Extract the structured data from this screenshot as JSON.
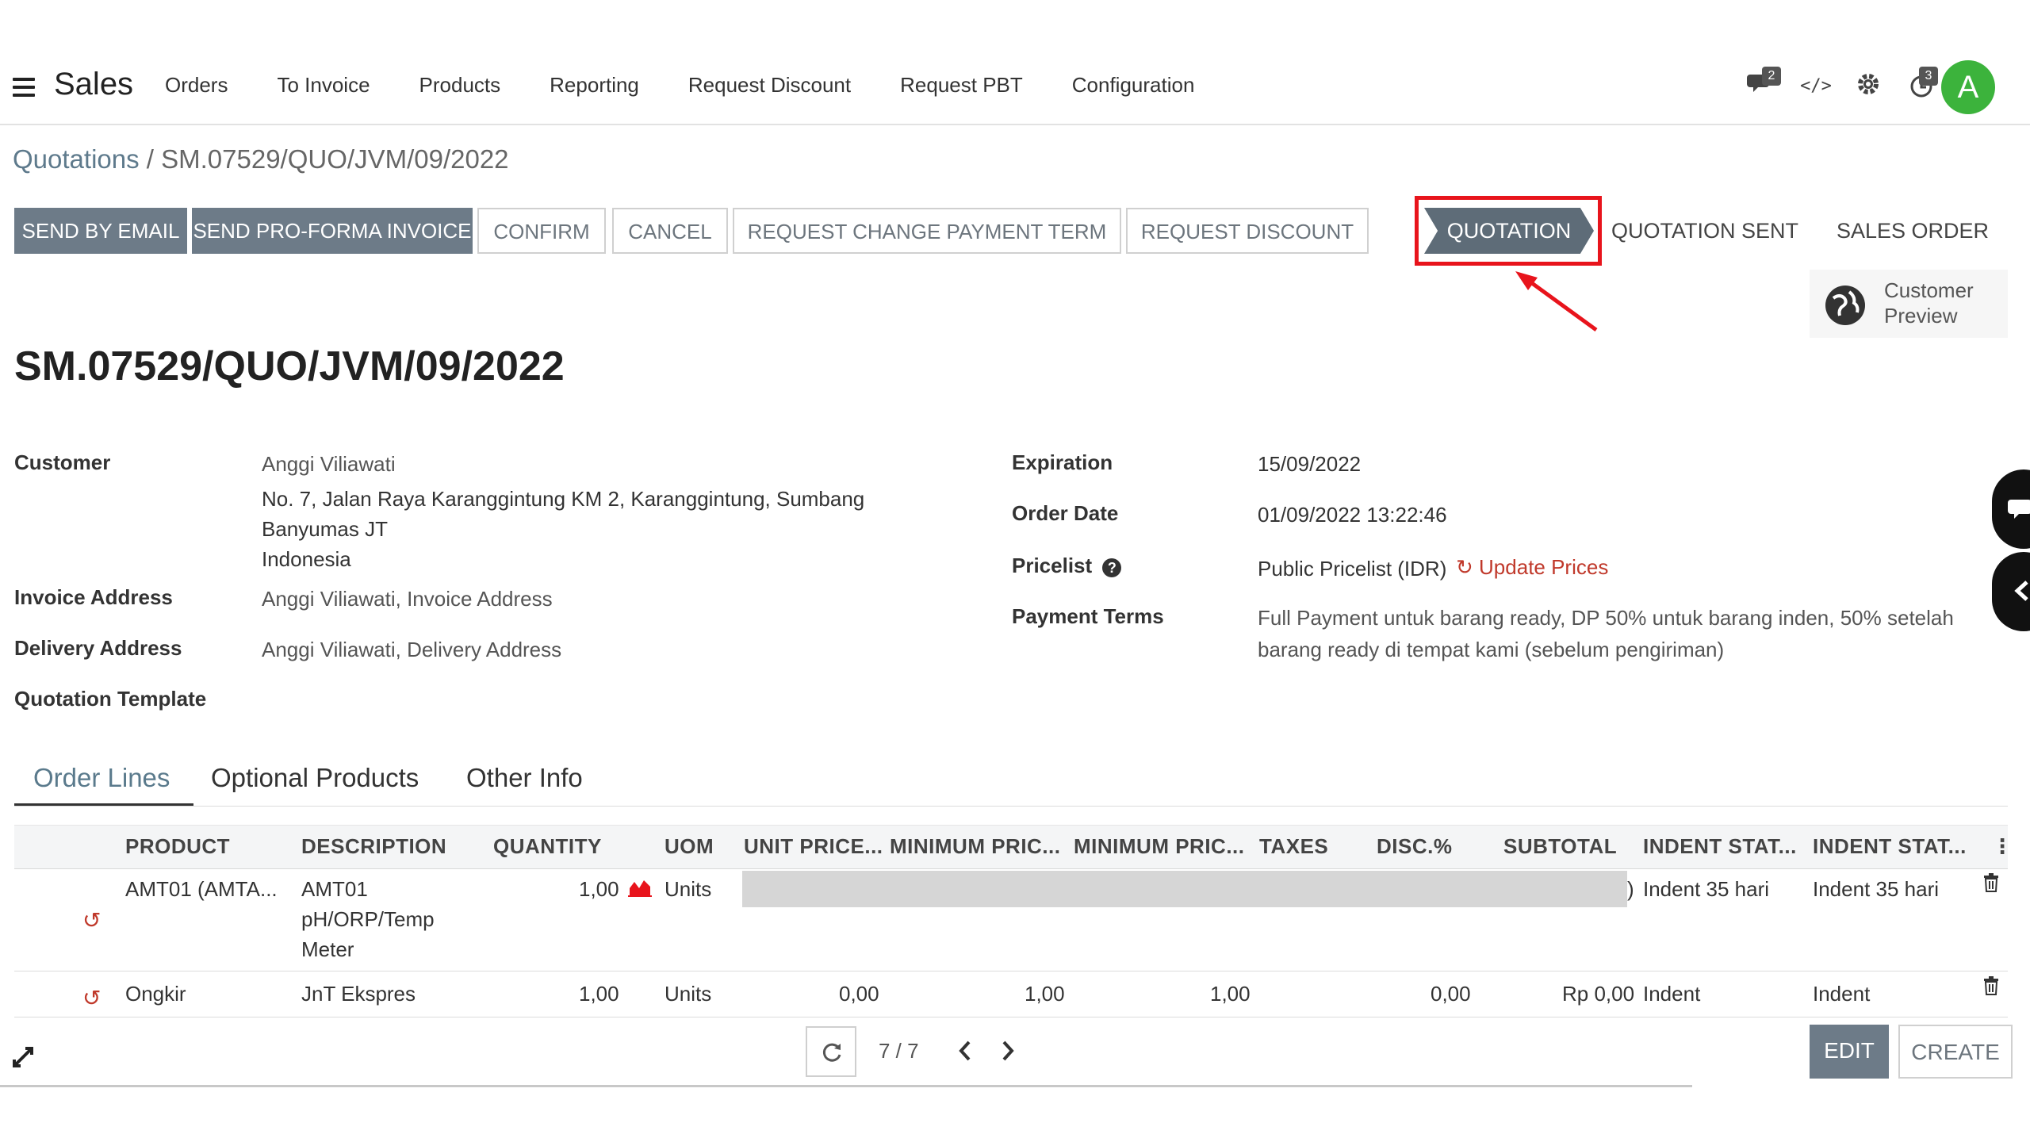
{
  "navbar": {
    "app_title": "Sales",
    "menu": [
      "Orders",
      "To Invoice",
      "Products",
      "Reporting",
      "Request Discount",
      "Request PBT",
      "Configuration"
    ],
    "messages_badge": "2",
    "activities_badge": "3",
    "avatar_letter": "A",
    "avatar_color": "#3cb33c"
  },
  "breadcrumb": {
    "parent": "Quotations",
    "separator": " / ",
    "current": "SM.07529/QUO/JVM/09/2022"
  },
  "actions": {
    "send_by_email": "SEND BY EMAIL",
    "send_proforma": "SEND PRO-FORMA INVOICE",
    "confirm": "CONFIRM",
    "cancel": "CANCEL",
    "request_change_payment_term": "REQUEST CHANGE PAYMENT TERM",
    "request_discount": "REQUEST DISCOUNT"
  },
  "statusbar": {
    "stages": [
      "QUOTATION",
      "QUOTATION SENT",
      "SALES ORDER"
    ],
    "active": "QUOTATION",
    "highlight_color": "#e8141c"
  },
  "customer_preview": {
    "line1": "Customer",
    "line2": "Preview"
  },
  "record": {
    "title": "SM.07529/QUO/JVM/09/2022"
  },
  "form": {
    "customer_label": "Customer",
    "customer_name": "Anggi Viliawati",
    "address_line1": "No. 7, Jalan Raya Karanggintung KM 2, Karanggintung, Sumbang",
    "address_line2": "Banyumas JT",
    "address_line3": "Indonesia",
    "invoice_address_label": "Invoice Address",
    "invoice_address": "Anggi Viliawati, Invoice Address",
    "delivery_address_label": "Delivery Address",
    "delivery_address": "Anggi Viliawati, Delivery Address",
    "quotation_template_label": "Quotation Template",
    "expiration_label": "Expiration",
    "expiration": "15/09/2022",
    "order_date_label": "Order Date",
    "order_date": "01/09/2022 13:22:46",
    "pricelist_label": "Pricelist",
    "pricelist": "Public Pricelist (IDR)",
    "update_prices": "Update Prices",
    "payment_terms_label": "Payment Terms",
    "payment_terms_line1": "Full Payment untuk barang ready, DP 50% untuk barang inden, 50% setelah",
    "payment_terms_line2": "barang ready di tempat kami (sebelum pengiriman)"
  },
  "tabs": [
    "Order Lines",
    "Optional Products",
    "Other Info"
  ],
  "table": {
    "headers": [
      "PRODUCT",
      "DESCRIPTION",
      "QUANTITY",
      "UOM",
      "UNIT PRICE...",
      "MINIMUM PRIC...",
      "MINIMUM PRIC...",
      "TAXES",
      "DISC.%",
      "SUBTOTAL",
      "INDENT STAT...",
      "INDENT STAT..."
    ],
    "rows": [
      {
        "product": "AMT01 (AMTA...",
        "description_1": "AMT01",
        "description_2": "pH/ORP/Temp",
        "description_3": "Meter",
        "quantity": "1,00",
        "uom": "Units",
        "subtotal_tail": ")",
        "indent_1": "Indent 35 hari",
        "indent_2": "Indent 35 hari"
      },
      {
        "product": "Ongkir",
        "description_1": "JnT Ekspres",
        "quantity": "1,00",
        "uom": "Units",
        "unit_price": "0,00",
        "min_price_1": "1,00",
        "min_price_2": "1,00",
        "disc": "0,00",
        "subtotal": "Rp 0,00",
        "indent_1": "Indent",
        "indent_2": "Indent"
      }
    ]
  },
  "pager": {
    "value": "7 / 7"
  },
  "footer": {
    "edit": "EDIT",
    "create": "CREATE"
  }
}
